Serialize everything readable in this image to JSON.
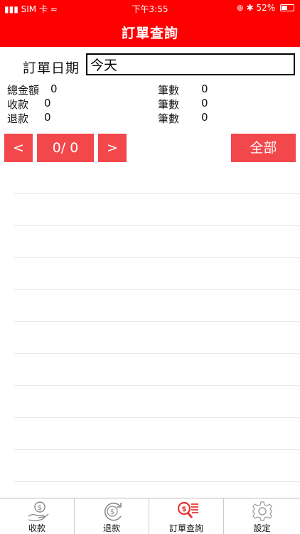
{
  "status_bar": {
    "carrier": "▮▮▮ SIM 卡",
    "wifi": "≈",
    "time": "下午3:55",
    "indicators": "⊕ ✱",
    "battery": "52%",
    "battery_level": 0.52
  },
  "header": {
    "title": "訂單查詢"
  },
  "filter": {
    "date_label": "訂單日期",
    "date_value": "今天"
  },
  "stats": [
    {
      "label": "總金額",
      "value": "0",
      "count_label": "筆數",
      "count": "0"
    },
    {
      "label": "收款",
      "value": "0",
      "count_label": "筆數",
      "count": "0"
    },
    {
      "label": "退款",
      "value": "0",
      "count_label": "筆數",
      "count": "0"
    }
  ],
  "pager": {
    "prev": "<",
    "page": "0/ 0",
    "next": ">"
  },
  "all_button": "全部",
  "tabs": [
    {
      "label": "收款",
      "icon": "money-hand-icon",
      "active": false
    },
    {
      "label": "退款",
      "icon": "refund-icon",
      "active": false
    },
    {
      "label": "訂單查詢",
      "icon": "order-search-icon",
      "active": true
    },
    {
      "label": "設定",
      "icon": "gear-icon",
      "active": false
    }
  ],
  "colors": {
    "brand": "#ff0000",
    "button": "#f2484c",
    "active_tab": "#e83030",
    "inactive_tab": "#999999"
  }
}
